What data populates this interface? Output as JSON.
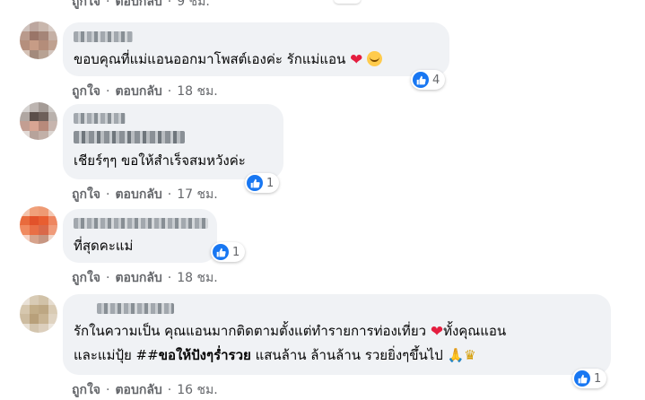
{
  "actions": {
    "like": "ถูกใจ",
    "reply": "ตอบกลับ",
    "separator": "·"
  },
  "top_partial": {
    "time": "9 ชม."
  },
  "comments": [
    {
      "text": "ขอบคุณที่แม่แอนออกมาโพสต์เองค่ะ รักแม่แอน",
      "emojis": [
        "heart-icon",
        "smiling-face-icon"
      ],
      "reaction_count": "4",
      "time": "18 ชม."
    },
    {
      "text": "เชียร์ๆๆ ขอให้สำเร็จสมหวังค่ะ",
      "reaction_count": "1",
      "time": "17 ชม."
    },
    {
      "text": "ที่สุดคะแม่",
      "reaction_count": "1",
      "time": "18 ชม."
    },
    {
      "line1": "รักในความเป็น คุณแอนมากติดตามตั้งแต่ทำรายการท่องเที่ยว",
      "line1_after": "ทั้งคุณแอน",
      "line2_prefix": "และแม่ปุ้ย ##",
      "line2_bold": "ขอให้ปังๆร่ำรวย",
      "line2_suffix": " แสนล้าน ล้านล้าน รวยยิ่งๆขึ้นไป",
      "reaction_count": "1",
      "time": "16 ชม."
    }
  ],
  "colors": {
    "bubble": "#f0f2f5",
    "meta_text": "#65676b",
    "like_blue": "#1877f2",
    "heart_red": "#e41e3f"
  }
}
